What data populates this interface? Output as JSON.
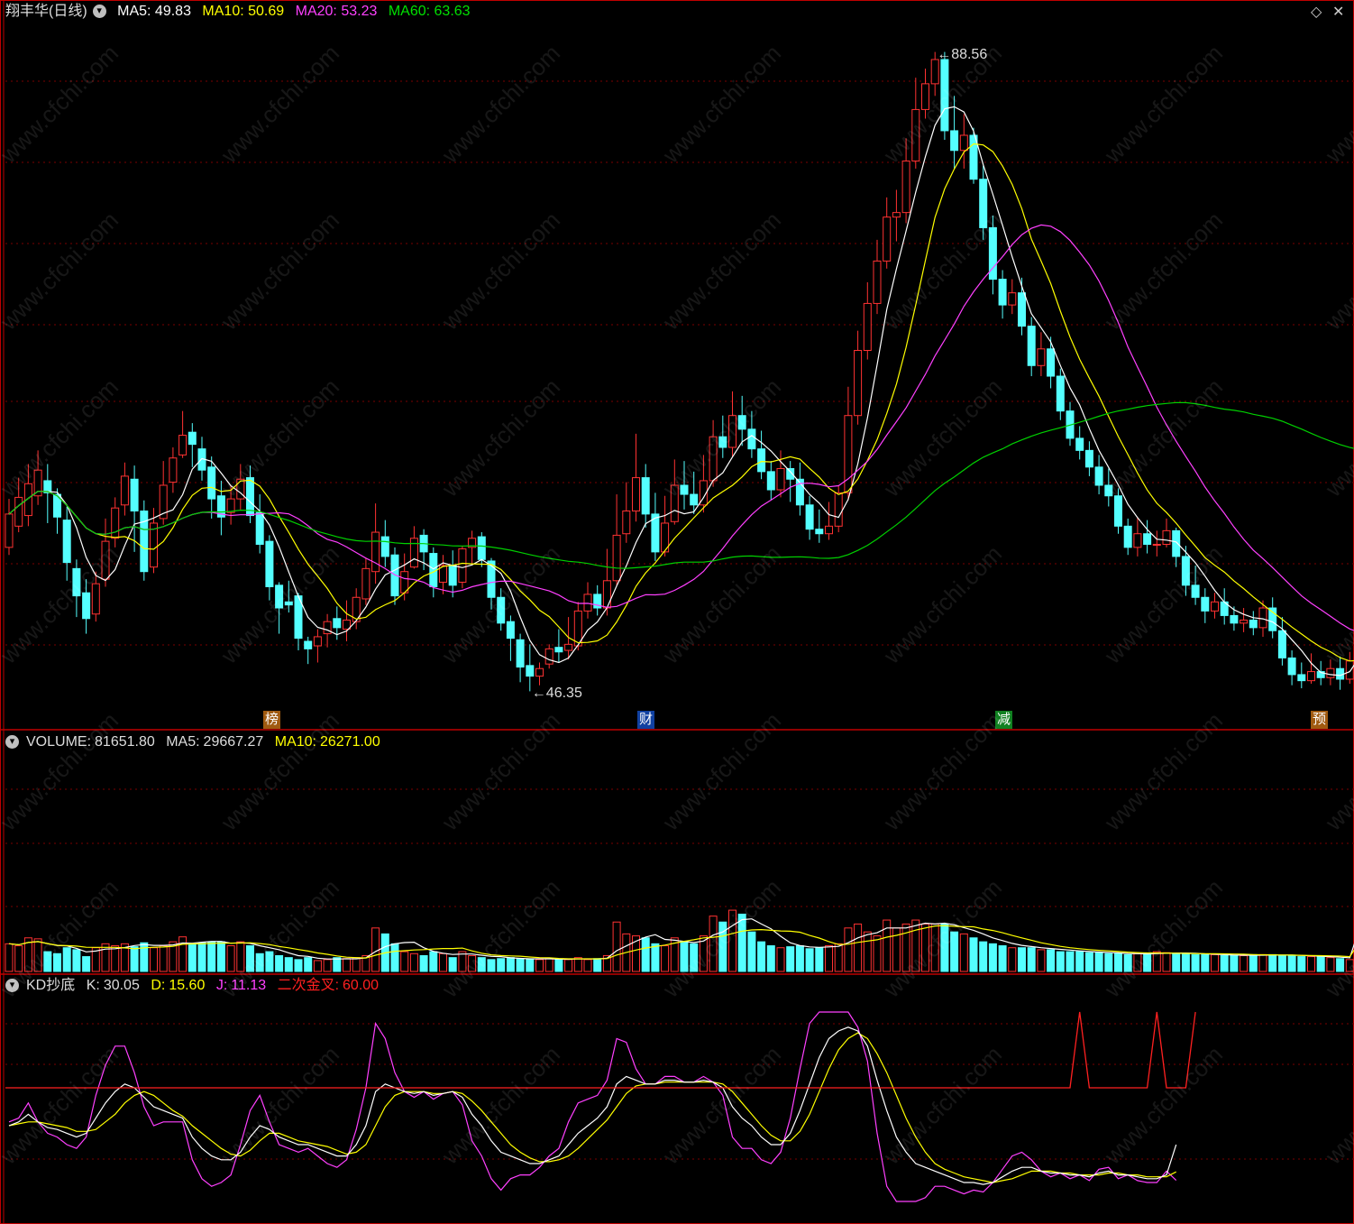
{
  "stock": {
    "name": "翔丰华(日线)"
  },
  "price_panel": {
    "indicators": [
      {
        "label": "MA5:",
        "value": "49.83",
        "color": "#ffffff"
      },
      {
        "label": "MA10:",
        "value": "50.69",
        "color": "#ffff00"
      },
      {
        "label": "MA20:",
        "value": "53.23",
        "color": "#ff40ff"
      },
      {
        "label": "MA60:",
        "value": "63.63",
        "color": "#00e000"
      }
    ],
    "high_label": "88.56",
    "low_label": "46.35",
    "event_tags": [
      {
        "text": "榜",
        "bg": "#a05a10"
      },
      {
        "text": "财",
        "bg": "#1040a0"
      },
      {
        "text": "减",
        "bg": "#108020"
      },
      {
        "text": "预",
        "bg": "#a05a10"
      }
    ]
  },
  "volume_panel": {
    "label": "VOLUME:",
    "value": "81651.80",
    "ma5_label": "MA5:",
    "ma5": "29667.27",
    "ma10_label": "MA10:",
    "ma10": "26271.00"
  },
  "kd_panel": {
    "title": "KD抄底",
    "k_label": "K:",
    "k": "30.05",
    "d_label": "D:",
    "d": "15.60",
    "j_label": "J:",
    "j": "11.13",
    "signal_label": "二次金叉:",
    "signal": "60.00"
  },
  "watermark": "www.cfchi.com",
  "colors": {
    "up": "#ff3232",
    "down": "#54ffff",
    "grid": "#7a0000",
    "frame": "#c00000"
  },
  "chart_data": {
    "type": "candlestick",
    "price_range": [
      44.4,
      90.6
    ],
    "volume_max": 110000,
    "kd_range": [
      0,
      100
    ],
    "kd_signal_level": 60,
    "candles": [
      [
        55.9,
        58.1,
        55.4,
        59.1,
        14000
      ],
      [
        57.3,
        59.2,
        56.9,
        60.5,
        13000
      ],
      [
        58.0,
        60.1,
        57.3,
        61.4,
        17000
      ],
      [
        59.3,
        61.0,
        58.7,
        62.3,
        16500
      ],
      [
        60.3,
        59.5,
        57.5,
        61.4,
        10000
      ],
      [
        59.4,
        57.9,
        56.8,
        59.8,
        9000
      ],
      [
        57.7,
        54.9,
        53.7,
        58.6,
        12000
      ],
      [
        54.5,
        52.7,
        51.3,
        55.1,
        11000
      ],
      [
        52.9,
        51.2,
        50.2,
        53.8,
        7500
      ],
      [
        51.5,
        53.5,
        51.0,
        54.3,
        12000
      ],
      [
        53.8,
        56.3,
        53.3,
        57.8,
        14000
      ],
      [
        56.5,
        58.5,
        55.9,
        59.2,
        13000
      ],
      [
        58.7,
        60.6,
        58.0,
        61.5,
        14000
      ],
      [
        60.4,
        58.3,
        55.6,
        61.3,
        12500
      ],
      [
        58.3,
        54.3,
        53.7,
        59.0,
        14500
      ],
      [
        54.6,
        57.5,
        54.2,
        58.5,
        12000
      ],
      [
        57.8,
        60.0,
        57.4,
        61.6,
        13000
      ],
      [
        60.2,
        61.8,
        59.5,
        62.5,
        15000
      ],
      [
        62.0,
        63.3,
        61.8,
        64.9,
        17500
      ],
      [
        63.5,
        62.7,
        61.2,
        64.1,
        14000
      ],
      [
        62.4,
        61.0,
        60.3,
        63.2,
        14500
      ],
      [
        61.2,
        59.1,
        57.8,
        61.9,
        15000
      ],
      [
        59.3,
        57.9,
        56.7,
        60.3,
        15000
      ],
      [
        58.2,
        59.1,
        57.4,
        60.0,
        13000
      ],
      [
        59.1,
        60.4,
        58.4,
        61.4,
        15000
      ],
      [
        60.5,
        58.0,
        57.5,
        61.3,
        13000
      ],
      [
        58.2,
        56.1,
        55.5,
        59.4,
        9000
      ],
      [
        56.3,
        53.3,
        52.4,
        56.7,
        10000
      ],
      [
        53.4,
        51.9,
        50.2,
        53.6,
        8000
      ],
      [
        52.3,
        52.1,
        51.6,
        53.7,
        7000
      ],
      [
        52.7,
        49.9,
        49.1,
        52.9,
        6000
      ],
      [
        49.7,
        49.2,
        48.2,
        50.0,
        7000
      ],
      [
        49.4,
        50.0,
        48.3,
        50.5,
        5500
      ],
      [
        50.2,
        51.0,
        49.3,
        51.5,
        6000
      ],
      [
        51.2,
        50.6,
        49.8,
        52.0,
        7000
      ],
      [
        50.5,
        51.1,
        49.7,
        52.4,
        6500
      ],
      [
        51.0,
        52.6,
        50.5,
        53.2,
        7000
      ],
      [
        52.5,
        54.5,
        52.1,
        55.2,
        8000
      ],
      [
        54.3,
        56.9,
        53.5,
        58.8,
        22000
      ],
      [
        56.6,
        55.3,
        54.6,
        57.7,
        19000
      ],
      [
        55.4,
        52.7,
        52.1,
        55.9,
        14000
      ],
      [
        52.9,
        54.3,
        52.4,
        55.5,
        10000
      ],
      [
        54.6,
        56.5,
        54.5,
        57.3,
        9000
      ],
      [
        56.7,
        55.6,
        54.4,
        57.1,
        8000
      ],
      [
        55.5,
        53.3,
        52.6,
        55.9,
        10000
      ],
      [
        53.6,
        54.7,
        52.8,
        55.4,
        9000
      ],
      [
        54.7,
        53.4,
        52.6,
        55.7,
        7000
      ],
      [
        53.6,
        55.8,
        53.2,
        56.0,
        10000
      ],
      [
        55.9,
        56.5,
        54.8,
        57.0,
        8000
      ],
      [
        56.6,
        55.1,
        54.6,
        56.9,
        7000
      ],
      [
        55.0,
        52.6,
        51.8,
        55.2,
        6000
      ],
      [
        52.6,
        50.9,
        50.4,
        53.2,
        6500
      ],
      [
        51.0,
        49.9,
        48.4,
        51.4,
        7000
      ],
      [
        49.8,
        48.0,
        47.0,
        50.2,
        6500
      ],
      [
        48.1,
        47.4,
        46.4,
        49.5,
        6000
      ],
      [
        47.4,
        47.9,
        46.8,
        48.3,
        6000
      ],
      [
        48.2,
        49.2,
        47.9,
        49.5,
        6500
      ],
      [
        49.3,
        49.0,
        48.3,
        50.5,
        6200
      ],
      [
        49.1,
        49.5,
        48.5,
        51.3,
        6000
      ],
      [
        49.4,
        51.7,
        49.1,
        52.3,
        7000
      ],
      [
        51.7,
        52.8,
        51.2,
        53.6,
        6000
      ],
      [
        52.8,
        51.9,
        51.4,
        53.4,
        6500
      ],
      [
        51.9,
        53.7,
        51.4,
        55.8,
        8000
      ],
      [
        53.7,
        56.7,
        53.4,
        59.4,
        25000
      ],
      [
        56.8,
        58.3,
        56.2,
        60.2,
        19000
      ],
      [
        58.3,
        60.5,
        57.6,
        63.4,
        18000
      ],
      [
        60.5,
        58.1,
        57.2,
        61.4,
        17000
      ],
      [
        58.1,
        55.6,
        55.0,
        59.5,
        14000
      ],
      [
        55.6,
        57.5,
        55.3,
        59.3,
        13000
      ],
      [
        57.6,
        60.0,
        57.4,
        61.7,
        17000
      ],
      [
        60.0,
        59.4,
        58.4,
        61.6,
        15000
      ],
      [
        59.4,
        58.7,
        58.1,
        60.9,
        14000
      ],
      [
        58.7,
        60.3,
        58.2,
        62.0,
        18000
      ],
      [
        60.3,
        63.2,
        59.9,
        64.3,
        28000
      ],
      [
        63.2,
        62.5,
        61.8,
        64.6,
        25000
      ],
      [
        62.5,
        64.6,
        61.9,
        66.2,
        31000
      ],
      [
        64.6,
        63.7,
        62.6,
        65.9,
        29000
      ],
      [
        63.7,
        62.4,
        61.8,
        64.9,
        20000
      ],
      [
        62.4,
        60.9,
        60.4,
        63.6,
        15000
      ],
      [
        60.9,
        59.7,
        59.0,
        61.6,
        13000
      ],
      [
        59.7,
        61.1,
        59.2,
        62.3,
        12000
      ],
      [
        61.1,
        60.4,
        58.9,
        61.6,
        12500
      ],
      [
        60.4,
        58.7,
        58.0,
        61.5,
        13000
      ],
      [
        58.7,
        57.1,
        56.4,
        59.3,
        11500
      ],
      [
        57.1,
        56.8,
        56.2,
        58.4,
        12000
      ],
      [
        56.8,
        57.3,
        56.4,
        58.9,
        13000
      ],
      [
        57.3,
        59.5,
        56.9,
        60.0,
        14000
      ],
      [
        59.5,
        64.6,
        59.0,
        66.5,
        22000
      ],
      [
        64.6,
        68.9,
        64.0,
        70.2,
        24000
      ],
      [
        68.9,
        72.0,
        68.3,
        73.4,
        20000
      ],
      [
        72.0,
        74.8,
        71.3,
        76.2,
        18000
      ],
      [
        74.8,
        77.7,
        74.3,
        79.0,
        26000
      ],
      [
        77.7,
        78.0,
        76.1,
        79.5,
        22000
      ],
      [
        78.0,
        81.4,
        77.3,
        82.9,
        24000
      ],
      [
        81.4,
        84.8,
        80.9,
        86.9,
        26000
      ],
      [
        84.8,
        86.5,
        84.2,
        87.5,
        24000
      ],
      [
        86.5,
        88.1,
        85.7,
        88.6,
        24000
      ],
      [
        88.1,
        83.4,
        82.8,
        88.6,
        24000
      ],
      [
        83.4,
        82.1,
        80.9,
        85.7,
        20000
      ],
      [
        82.1,
        83.1,
        80.9,
        84.5,
        19000
      ],
      [
        83.1,
        80.2,
        79.9,
        83.6,
        17000
      ],
      [
        80.2,
        77.0,
        76.2,
        81.1,
        15000
      ],
      [
        77.0,
        73.6,
        72.6,
        77.8,
        14000
      ],
      [
        73.6,
        71.9,
        71.0,
        74.2,
        13000
      ],
      [
        71.9,
        72.7,
        71.3,
        73.6,
        12000
      ],
      [
        72.7,
        70.5,
        69.9,
        73.7,
        12000
      ],
      [
        70.5,
        67.9,
        67.2,
        71.1,
        12000
      ],
      [
        67.9,
        69.0,
        67.2,
        70.1,
        11000
      ],
      [
        69.0,
        67.2,
        66.4,
        69.8,
        11000
      ],
      [
        67.2,
        64.9,
        64.3,
        67.7,
        10000
      ],
      [
        64.9,
        63.1,
        62.6,
        65.5,
        10000
      ],
      [
        63.1,
        62.3,
        61.7,
        63.9,
        10000
      ],
      [
        62.3,
        61.2,
        60.6,
        62.9,
        9500
      ],
      [
        61.2,
        60.0,
        59.4,
        62.0,
        9500
      ],
      [
        60.0,
        59.3,
        58.6,
        61.1,
        9000
      ],
      [
        59.3,
        57.3,
        56.8,
        59.8,
        9000
      ],
      [
        57.3,
        55.9,
        55.4,
        57.8,
        8500
      ],
      [
        55.9,
        56.8,
        55.3,
        57.9,
        9000
      ],
      [
        56.8,
        56.1,
        55.5,
        57.7,
        9000
      ],
      [
        56.1,
        56.1,
        55.3,
        57.0,
        10000
      ],
      [
        56.1,
        57.0,
        55.9,
        57.8,
        9500
      ],
      [
        57.0,
        55.3,
        54.6,
        57.2,
        9000
      ],
      [
        55.3,
        53.4,
        52.7,
        56.0,
        9000
      ],
      [
        53.4,
        52.6,
        52.1,
        54.7,
        8500
      ],
      [
        52.6,
        51.7,
        50.9,
        53.2,
        8500
      ],
      [
        51.7,
        52.3,
        51.2,
        52.9,
        8500
      ],
      [
        52.3,
        51.4,
        50.8,
        53.2,
        8000
      ],
      [
        51.4,
        50.9,
        50.4,
        52.0,
        8000
      ],
      [
        50.9,
        51.1,
        50.3,
        51.9,
        8000
      ],
      [
        51.1,
        50.6,
        50.1,
        51.7,
        8500
      ],
      [
        50.6,
        51.9,
        50.0,
        52.4,
        8500
      ],
      [
        51.9,
        50.4,
        49.9,
        52.6,
        8500
      ],
      [
        50.4,
        48.6,
        48.1,
        51.3,
        8000
      ],
      [
        48.6,
        47.5,
        46.8,
        49.1,
        8000
      ],
      [
        47.5,
        47.1,
        46.6,
        48.3,
        7500
      ],
      [
        47.1,
        47.7,
        46.9,
        48.9,
        7500
      ],
      [
        47.7,
        47.3,
        46.8,
        48.4,
        7500
      ],
      [
        47.3,
        47.9,
        46.8,
        48.5,
        7000
      ],
      [
        47.9,
        47.2,
        46.5,
        48.7,
        6500
      ],
      [
        47.2,
        48.4,
        46.9,
        49.0,
        6000
      ],
      [
        48.4,
        52.4,
        48.2,
        53.8,
        81651.8
      ]
    ],
    "kd": {
      "k": [
        40,
        42,
        46,
        42,
        39,
        38,
        36,
        34,
        36,
        44,
        52,
        58,
        62,
        60,
        55,
        50,
        48,
        46,
        44,
        34,
        28,
        24,
        22,
        22,
        26,
        34,
        40,
        38,
        34,
        32,
        30,
        30,
        28,
        26,
        24,
        24,
        30,
        40,
        58,
        62,
        60,
        58,
        57,
        58,
        56,
        57,
        58,
        55,
        46,
        40,
        32,
        26,
        24,
        22,
        20,
        20,
        22,
        24,
        30,
        36,
        40,
        44,
        50,
        62,
        66,
        64,
        62,
        62,
        64,
        64,
        63,
        63,
        64,
        63,
        60,
        50,
        44,
        40,
        34,
        30,
        30,
        36,
        48,
        62,
        76,
        86,
        90,
        92,
        90,
        82,
        64,
        48,
        34,
        26,
        20,
        18,
        16,
        14,
        12,
        10,
        10,
        9,
        10,
        13,
        16,
        18,
        18,
        16,
        15,
        15,
        14,
        14,
        13,
        15,
        16,
        14,
        14,
        13,
        12,
        12,
        14,
        30
      ],
      "d": [
        40,
        41,
        42,
        42,
        41,
        40,
        39,
        37,
        37,
        38,
        42,
        46,
        52,
        56,
        58,
        56,
        52,
        48,
        45,
        40,
        36,
        32,
        28,
        25,
        24,
        27,
        32,
        36,
        36,
        34,
        32,
        31,
        30,
        29,
        27,
        25,
        26,
        30,
        40,
        50,
        56,
        58,
        58,
        58,
        57,
        57,
        58,
        57,
        53,
        48,
        42,
        36,
        30,
        26,
        23,
        21,
        21,
        22,
        24,
        28,
        33,
        38,
        43,
        50,
        57,
        61,
        62,
        62,
        63,
        63,
        63,
        63,
        63,
        63,
        62,
        58,
        52,
        46,
        40,
        35,
        32,
        32,
        37,
        46,
        58,
        70,
        80,
        86,
        89,
        86,
        78,
        68,
        56,
        44,
        34,
        26,
        20,
        17,
        15,
        13,
        12,
        11,
        10,
        11,
        12,
        14,
        16,
        16,
        16,
        15,
        15,
        14,
        14,
        14,
        15,
        15,
        14,
        14,
        13,
        13,
        13,
        15.6
      ],
      "j": [
        42,
        44,
        52,
        42,
        36,
        34,
        30,
        28,
        34,
        56,
        72,
        82,
        82,
        68,
        50,
        40,
        42,
        42,
        42,
        22,
        12,
        8,
        10,
        14,
        30,
        48,
        56,
        42,
        30,
        28,
        26,
        28,
        24,
        20,
        18,
        22,
        38,
        60,
        94,
        86,
        68,
        58,
        55,
        58,
        54,
        57,
        58,
        51,
        32,
        24,
        12,
        6,
        12,
        14,
        14,
        18,
        24,
        28,
        42,
        52,
        54,
        56,
        64,
        86,
        84,
        70,
        62,
        62,
        66,
        66,
        63,
        63,
        66,
        63,
        56,
        34,
        28,
        28,
        22,
        20,
        26,
        44,
        70,
        94,
        100,
        100,
        100,
        100,
        92,
        74,
        36,
        8,
        0,
        0,
        0,
        2,
        8,
        8,
        6,
        4,
        6,
        5,
        10,
        17,
        24,
        26,
        22,
        16,
        13,
        15,
        12,
        14,
        11,
        17,
        18,
        12,
        14,
        11,
        10,
        10,
        16,
        11.13
      ],
      "signal": [
        0,
        0,
        0,
        0,
        0,
        0,
        0,
        0,
        0,
        0,
        0,
        0,
        0,
        0,
        0,
        0,
        0,
        0,
        0,
        0,
        0,
        0,
        0,
        0,
        0,
        0,
        0,
        0,
        0,
        0,
        0,
        0,
        0,
        0,
        0,
        0,
        0,
        0,
        0,
        0,
        0,
        0,
        0,
        0,
        0,
        0,
        0,
        0,
        0,
        0,
        0,
        0,
        0,
        0,
        0,
        0,
        0,
        0,
        0,
        0,
        0,
        0,
        0,
        0,
        0,
        0,
        0,
        0,
        0,
        0,
        0,
        0,
        0,
        0,
        0,
        0,
        0,
        0,
        0,
        0,
        0,
        0,
        0,
        0,
        0,
        0,
        0,
        0,
        0,
        0,
        0,
        0,
        0,
        0,
        0,
        0,
        0,
        0,
        0,
        0,
        0,
        0,
        0,
        0,
        0,
        0,
        0,
        0,
        0,
        0,
        0,
        1,
        0,
        0,
        0,
        0,
        0,
        0,
        0,
        1,
        0,
        0,
        0,
        1
      ]
    }
  }
}
